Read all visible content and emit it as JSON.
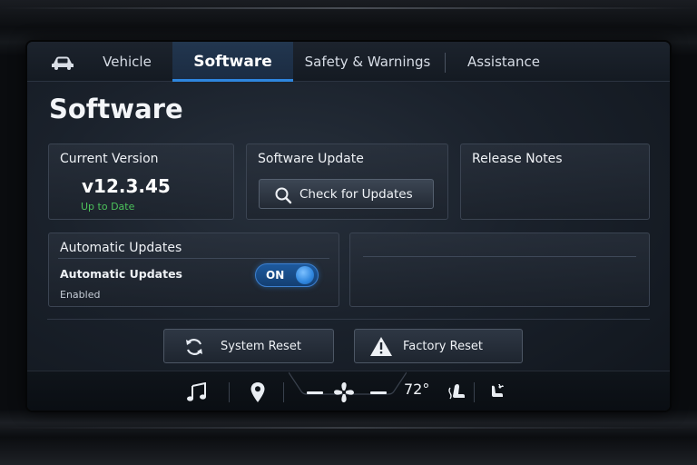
{
  "tabs": {
    "vehicle": "Vehicle",
    "software": "Software",
    "safety": "Safety & Warnings",
    "assistance": "Assistance"
  },
  "page": {
    "title": "Software"
  },
  "current_version": {
    "title": "Current Version",
    "version": "v12.3.45",
    "status": "Up to Date",
    "status_color": "#4cc25b"
  },
  "software_update": {
    "title": "Software Update",
    "button": "Check for Updates"
  },
  "release_notes": {
    "title": "Release Notes"
  },
  "automatic_updates": {
    "title": "Automatic Updates",
    "label": "Automatic Updates",
    "state": "Enabled",
    "toggle": "ON"
  },
  "actions": {
    "system_reset": "System Reset",
    "factory_reset": "Factory Reset"
  },
  "climate": {
    "temperature": "72°"
  },
  "icons": [
    "car-icon",
    "search-icon",
    "refresh-icon",
    "warning-icon",
    "music-icon",
    "location-pin-icon",
    "fan-icon",
    "heated-seat-icon",
    "seat-fan-icon"
  ],
  "colors": {
    "accent": "#2e86de",
    "status_ok": "#4cc25b"
  }
}
